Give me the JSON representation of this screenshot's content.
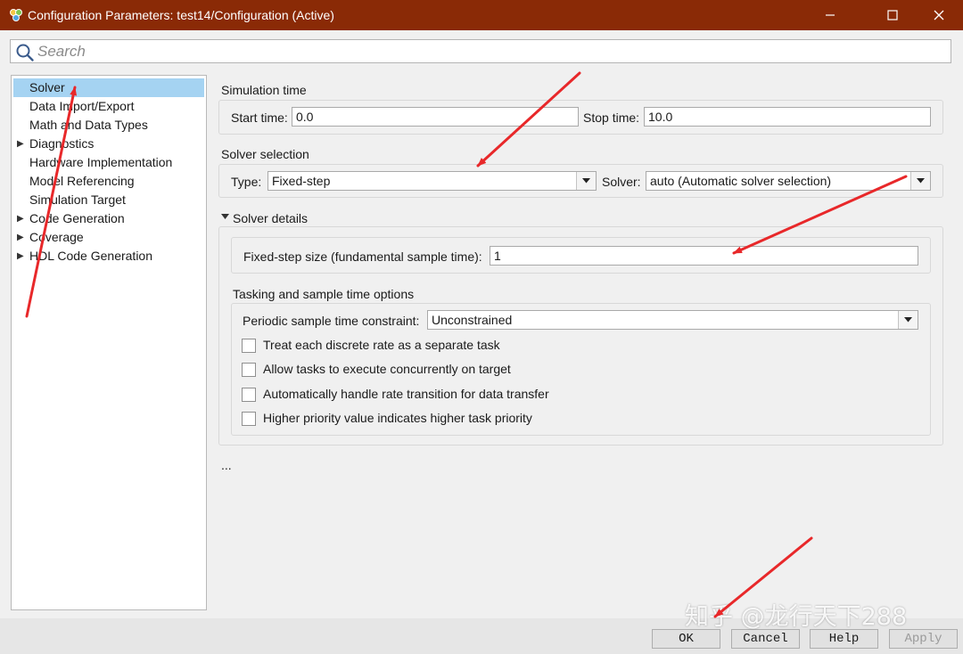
{
  "window": {
    "title": "Configuration Parameters: test14/Configuration (Active)",
    "controls": {
      "minimize": "–",
      "maximize": "☐",
      "close": "✕"
    }
  },
  "search": {
    "placeholder": "Search",
    "value": ""
  },
  "nav": {
    "items": [
      {
        "label": "Solver",
        "selected": true,
        "expandable": false
      },
      {
        "label": "Data Import/Export",
        "expandable": false
      },
      {
        "label": "Math and Data Types",
        "expandable": false
      },
      {
        "label": "Diagnostics",
        "expandable": true
      },
      {
        "label": "Hardware Implementation",
        "expandable": false
      },
      {
        "label": "Model Referencing",
        "expandable": false
      },
      {
        "label": "Simulation Target",
        "expandable": false
      },
      {
        "label": "Code Generation",
        "expandable": true
      },
      {
        "label": "Coverage",
        "expandable": true
      },
      {
        "label": "HDL Code Generation",
        "expandable": true
      }
    ]
  },
  "simulation_time": {
    "heading": "Simulation time",
    "start_label": "Start time:",
    "start_value": "0.0",
    "stop_label": "Stop time:",
    "stop_value": "10.0"
  },
  "solver_selection": {
    "heading": "Solver selection",
    "type_label": "Type:",
    "type_value": "Fixed-step",
    "solver_label": "Solver:",
    "solver_value": "auto (Automatic solver selection)"
  },
  "solver_details": {
    "heading": "Solver details",
    "step_label": "Fixed-step size (fundamental sample time):",
    "step_value": "1"
  },
  "tasking": {
    "heading": "Tasking and sample time options",
    "constraint_label": "Periodic sample time constraint:",
    "constraint_value": "Unconstrained",
    "checkboxes": [
      {
        "label": "Treat each discrete rate as a separate task",
        "checked": false
      },
      {
        "label": "Allow tasks to execute concurrently on target",
        "checked": false
      },
      {
        "label": "Automatically handle rate transition for data transfer",
        "checked": false
      },
      {
        "label": "Higher priority value indicates higher task priority",
        "checked": false
      }
    ]
  },
  "more": "...",
  "buttons": {
    "ok": "OK",
    "cancel": "Cancel",
    "help": "Help",
    "apply": "Apply"
  },
  "watermark": "知乎 @龙行天下288",
  "colors": {
    "titlebar": "#8a2a06",
    "selection": "#a5d3f2",
    "annotation_arrow": "#e8282a"
  }
}
